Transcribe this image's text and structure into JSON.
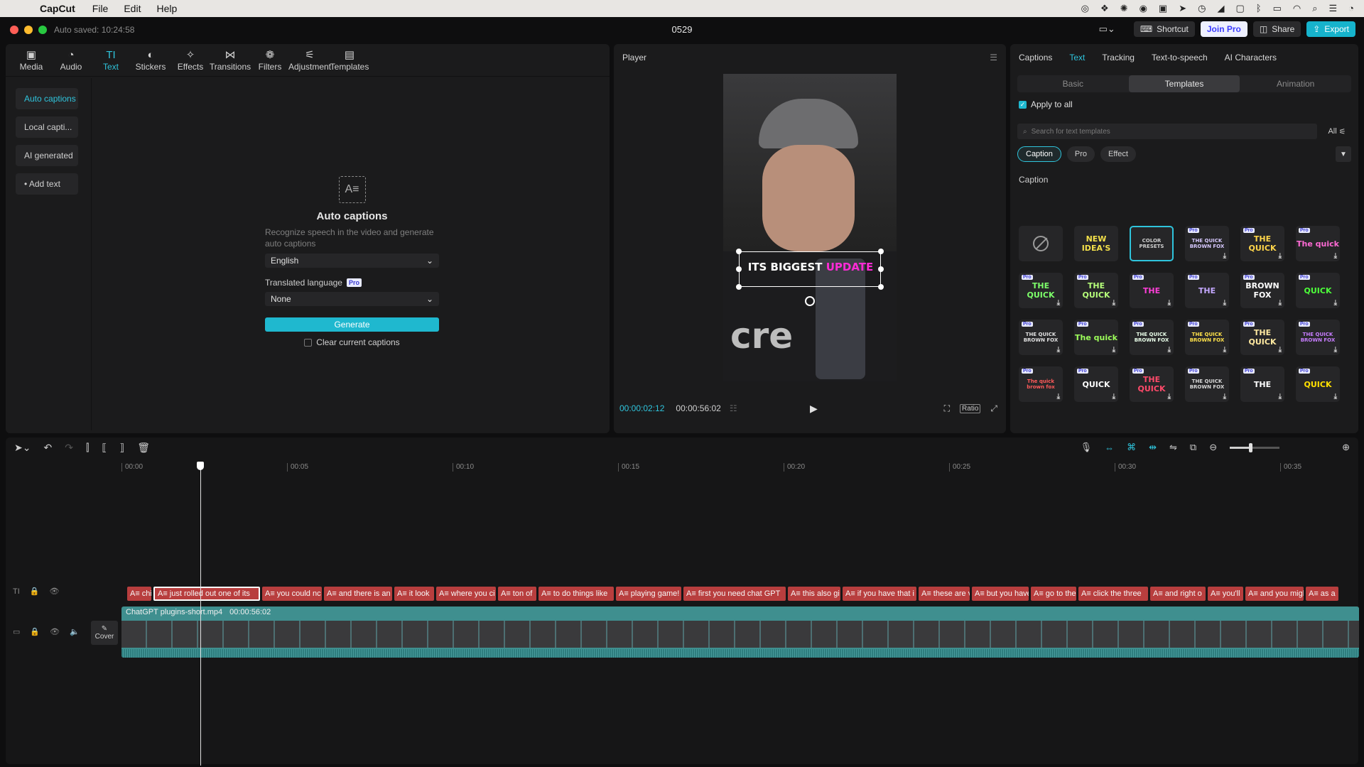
{
  "menubar": {
    "app": "CapCut",
    "menus": [
      "File",
      "Edit",
      "Help"
    ]
  },
  "titlebar": {
    "autosaved": "Auto saved: 10:24:58",
    "project": "0529",
    "shortcut": "Shortcut",
    "join_pro": "Join Pro",
    "share": "Share",
    "export": "Export"
  },
  "toolbar": {
    "items": [
      {
        "label": "Media",
        "icon": "▣"
      },
      {
        "label": "Audio",
        "icon": "◔"
      },
      {
        "label": "Text",
        "icon": "TI"
      },
      {
        "label": "Stickers",
        "icon": "◐"
      },
      {
        "label": "Effects",
        "icon": "✧"
      },
      {
        "label": "Transitions",
        "icon": "⋈"
      },
      {
        "label": "Filters",
        "icon": "❁"
      },
      {
        "label": "Adjustment",
        "icon": "⚟"
      },
      {
        "label": "Templates",
        "icon": "▤"
      }
    ]
  },
  "sidenav": {
    "auto_captions": "Auto captions",
    "local_captions": "Local capti...",
    "ai_generated": "AI generated",
    "add_text": "• Add text"
  },
  "auto_captions": {
    "icon": "A≡",
    "title": "Auto captions",
    "description": "Recognize speech in the video and generate auto captions",
    "language": "English",
    "translated_label": "Translated language",
    "pro_badge": "Pro",
    "translated_value": "None",
    "generate": "Generate",
    "clear": "Clear current captions"
  },
  "player": {
    "title": "Player",
    "caption_part1": "ITS BIGGEST ",
    "caption_part2": "UPDATE",
    "bg_text": "cre",
    "current_time": "00:00:02:12",
    "total_time": "00:00:56:02",
    "ratio": "Ratio"
  },
  "rightpanel": {
    "tabs": [
      "Captions",
      "Text",
      "Tracking",
      "Text-to-speech",
      "AI Characters"
    ],
    "subtabs": [
      "Basic",
      "Templates",
      "Animation"
    ],
    "apply_all": "Apply to all",
    "search_placeholder": "Search for text templates",
    "filter_all": "All",
    "chips": [
      "Caption",
      "Pro",
      "Effect"
    ],
    "section": "Caption",
    "templates": [
      {
        "text": "",
        "color": "#fff",
        "pro": false,
        "none": true
      },
      {
        "text": "NEW IDEA'S",
        "color": "#f3e04a",
        "pro": false
      },
      {
        "text": "COLOR PRESETS",
        "color": "#cfcfcf",
        "pro": false,
        "sel": true
      },
      {
        "text": "THE QUICK BROWN FOX",
        "color": "#d7c9ff",
        "pro": true
      },
      {
        "text": "THE QUICK",
        "color": "#ffd54a",
        "pro": true
      },
      {
        "text": "The quick",
        "color": "#ff6ad5",
        "pro": true
      },
      {
        "text": "THE QUICK",
        "color": "#7dff6a",
        "pro": true
      },
      {
        "text": "THE QUICK",
        "color": "#b6ff7a",
        "pro": true
      },
      {
        "text": "THE",
        "color": "#ff3fd8",
        "pro": true
      },
      {
        "text": "THE",
        "color": "#c4a8ff",
        "pro": true
      },
      {
        "text": "BROWN FOX",
        "color": "#ffffff",
        "pro": true
      },
      {
        "text": "QUICK",
        "color": "#4dff3a",
        "pro": true
      },
      {
        "text": "THE QUICK BROWN FOX",
        "color": "#e0e0e0",
        "pro": true
      },
      {
        "text": "The quick",
        "color": "#9dff5a",
        "pro": true
      },
      {
        "text": "THE QUICK BROWN FOX",
        "color": "#eaffea",
        "pro": true
      },
      {
        "text": "THE QUICK BROWN FOX",
        "color": "#ffe24a",
        "pro": true
      },
      {
        "text": "THE QUICK",
        "color": "#ffe9a0",
        "pro": true
      },
      {
        "text": "THE QUICK BROWN FOX",
        "color": "#c77dff",
        "pro": true
      },
      {
        "text": "The quick brown fox",
        "color": "#ff5a5a",
        "pro": true
      },
      {
        "text": "QUICK",
        "color": "#ffffff",
        "pro": true
      },
      {
        "text": "THE QUICK",
        "color": "#ff4a6a",
        "pro": true
      },
      {
        "text": "THE QUICK BROWN FOX",
        "color": "#d8d8d8",
        "pro": true
      },
      {
        "text": "THE",
        "color": "#ffffff",
        "pro": true
      },
      {
        "text": "QUICK",
        "color": "#ffe000",
        "pro": true
      }
    ]
  },
  "timeline": {
    "ticks": [
      "00:00",
      "00:05",
      "00:10",
      "00:15",
      "00:20",
      "00:25",
      "00:30",
      "00:35"
    ],
    "clip_name": "ChatGPT plugins-short.mp4",
    "clip_duration": "00:00:56:02",
    "cover": "Cover",
    "captions": [
      {
        "t": "A≡ chi",
        "w": 34
      },
      {
        "t": "A≡ just rolled out one of its",
        "w": 150,
        "sel": true
      },
      {
        "t": "A≡ you could nc",
        "w": 84
      },
      {
        "t": "A≡ and there is an",
        "w": 96
      },
      {
        "t": "A≡ it look",
        "w": 56
      },
      {
        "t": "A≡ where you ci",
        "w": 84
      },
      {
        "t": "A≡ ton of",
        "w": 54
      },
      {
        "t": "A≡ to do things like",
        "w": 106
      },
      {
        "t": "A≡ playing game!",
        "w": 92
      },
      {
        "t": "A≡ first you need chat GPT",
        "w": 144
      },
      {
        "t": "A≡ this also gi",
        "w": 74
      },
      {
        "t": "A≡ if you have that i",
        "w": 104
      },
      {
        "t": "A≡ these are v",
        "w": 72
      },
      {
        "t": "A≡ but you have",
        "w": 80
      },
      {
        "t": "A≡ go to the",
        "w": 64
      },
      {
        "t": "A≡ click the three",
        "w": 98
      },
      {
        "t": "A≡ and right o",
        "w": 78
      },
      {
        "t": "A≡ you'll",
        "w": 50
      },
      {
        "t": "A≡ and you migl",
        "w": 82
      },
      {
        "t": "A≡ as a",
        "w": 46
      }
    ]
  },
  "icons": {
    "apple": "",
    "dropdown": "⌄",
    "play": "▶",
    "download": "⤓",
    "search": "⌕",
    "check": "✓",
    "filter": "⚲"
  },
  "colors": {
    "accent": "#2fc4dc",
    "caption_track": "#b83e3e",
    "video_track": "#3f8f8f"
  }
}
